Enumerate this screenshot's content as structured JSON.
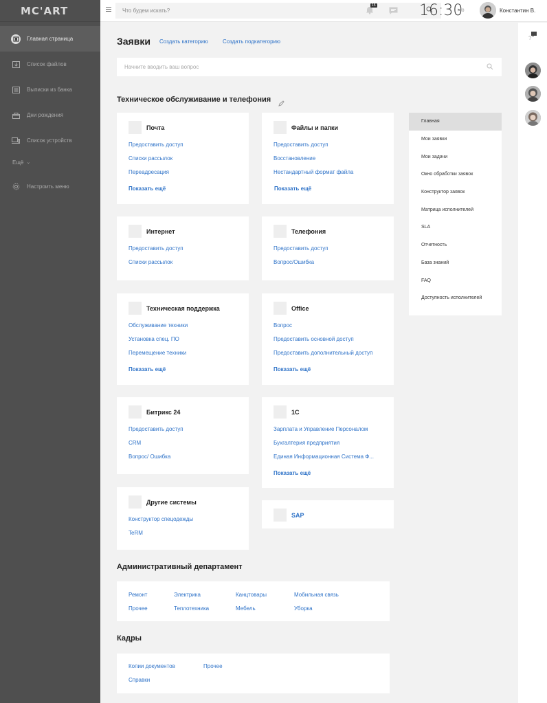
{
  "brand": {
    "logo": "MC'ART"
  },
  "sidebar": {
    "items": [
      {
        "label": "Главная страница",
        "icon": "home-icon"
      },
      {
        "label": "Список файлов",
        "icon": "files-icon"
      },
      {
        "label": "Выписки из банка",
        "icon": "bank-icon"
      },
      {
        "label": "Дни рождения",
        "icon": "gift-icon"
      },
      {
        "label": "Список устройств",
        "icon": "devices-icon"
      }
    ],
    "more": "Ещё",
    "settings": "Настроить меню"
  },
  "topbar": {
    "search_placeholder": "Что будем искать?",
    "notifications_count": "15",
    "clock": "16:30",
    "flag_count": "0",
    "user_name": "Константин В."
  },
  "main": {
    "title": "Заявки",
    "create_category": "Создать категорию",
    "create_subcategory": "Создать подкатегорию",
    "question_placeholder": "Начните вводить ваш вопрос",
    "section1": "Техническое обслуживание и телефония",
    "cards": [
      {
        "title": "Почта",
        "links": [
          "Предоставить доступ",
          "Списки рассылок",
          "Переадресация"
        ],
        "more": "Показать ещё"
      },
      {
        "title": "Файлы и папки",
        "links": [
          "Предоставить доступ",
          "Восстановление",
          "Нестандартный формат файла"
        ],
        "more": "Показать ещё"
      },
      {
        "title": "Интернет",
        "links": [
          "Предоставить доступ",
          "Списки рассылок"
        ]
      },
      {
        "title": "Телефония",
        "links": [
          "Предоставить доступ",
          "Вопрос/Ошибка"
        ]
      },
      {
        "title": "Техническая поддержка",
        "links": [
          "Обслуживание техники",
          "Установка спец. ПО",
          "Перемещение техники"
        ],
        "more": "Показать ещё"
      },
      {
        "title": "Office",
        "links": [
          "Вопрос",
          "Предоставить основной доступ",
          "Предоставить дополнительный доступ"
        ],
        "more": "Показать ещё"
      },
      {
        "title": "Битрикс 24",
        "links": [
          "Предоставить доступ",
          "CRM",
          "Вопрос/ Ошибка"
        ]
      },
      {
        "title": "1С",
        "links": [
          "Зарплата и Управление Персоналом",
          "Бухгалтерия предприятия",
          "Единая Информационная Система Ф..."
        ],
        "more": "Показать ещё"
      },
      {
        "title": "Другие системы",
        "links": [
          "Конструктор спецодежды",
          "TeRM"
        ]
      },
      {
        "title": "SAP",
        "links": []
      }
    ],
    "section2": "Административный департамент",
    "admin_links": [
      "Ремонт",
      "Электрика",
      "Канцтовары",
      "Мобильная связь",
      "Прочее",
      "Теплотехника",
      "Мебель",
      "Уборка"
    ],
    "section3": "Кадры",
    "hr_links": [
      "Копии документов",
      "Прочее",
      "Справки"
    ]
  },
  "side_menu": [
    "Главная",
    "Мои заявки",
    "Мои задачи",
    "Окно обработки заявок",
    "Конструктор заявок",
    "Матрица исполнителей",
    "SLA",
    "Отчетность",
    "База знаний",
    "FAQ",
    "Доступность исполнителей"
  ]
}
